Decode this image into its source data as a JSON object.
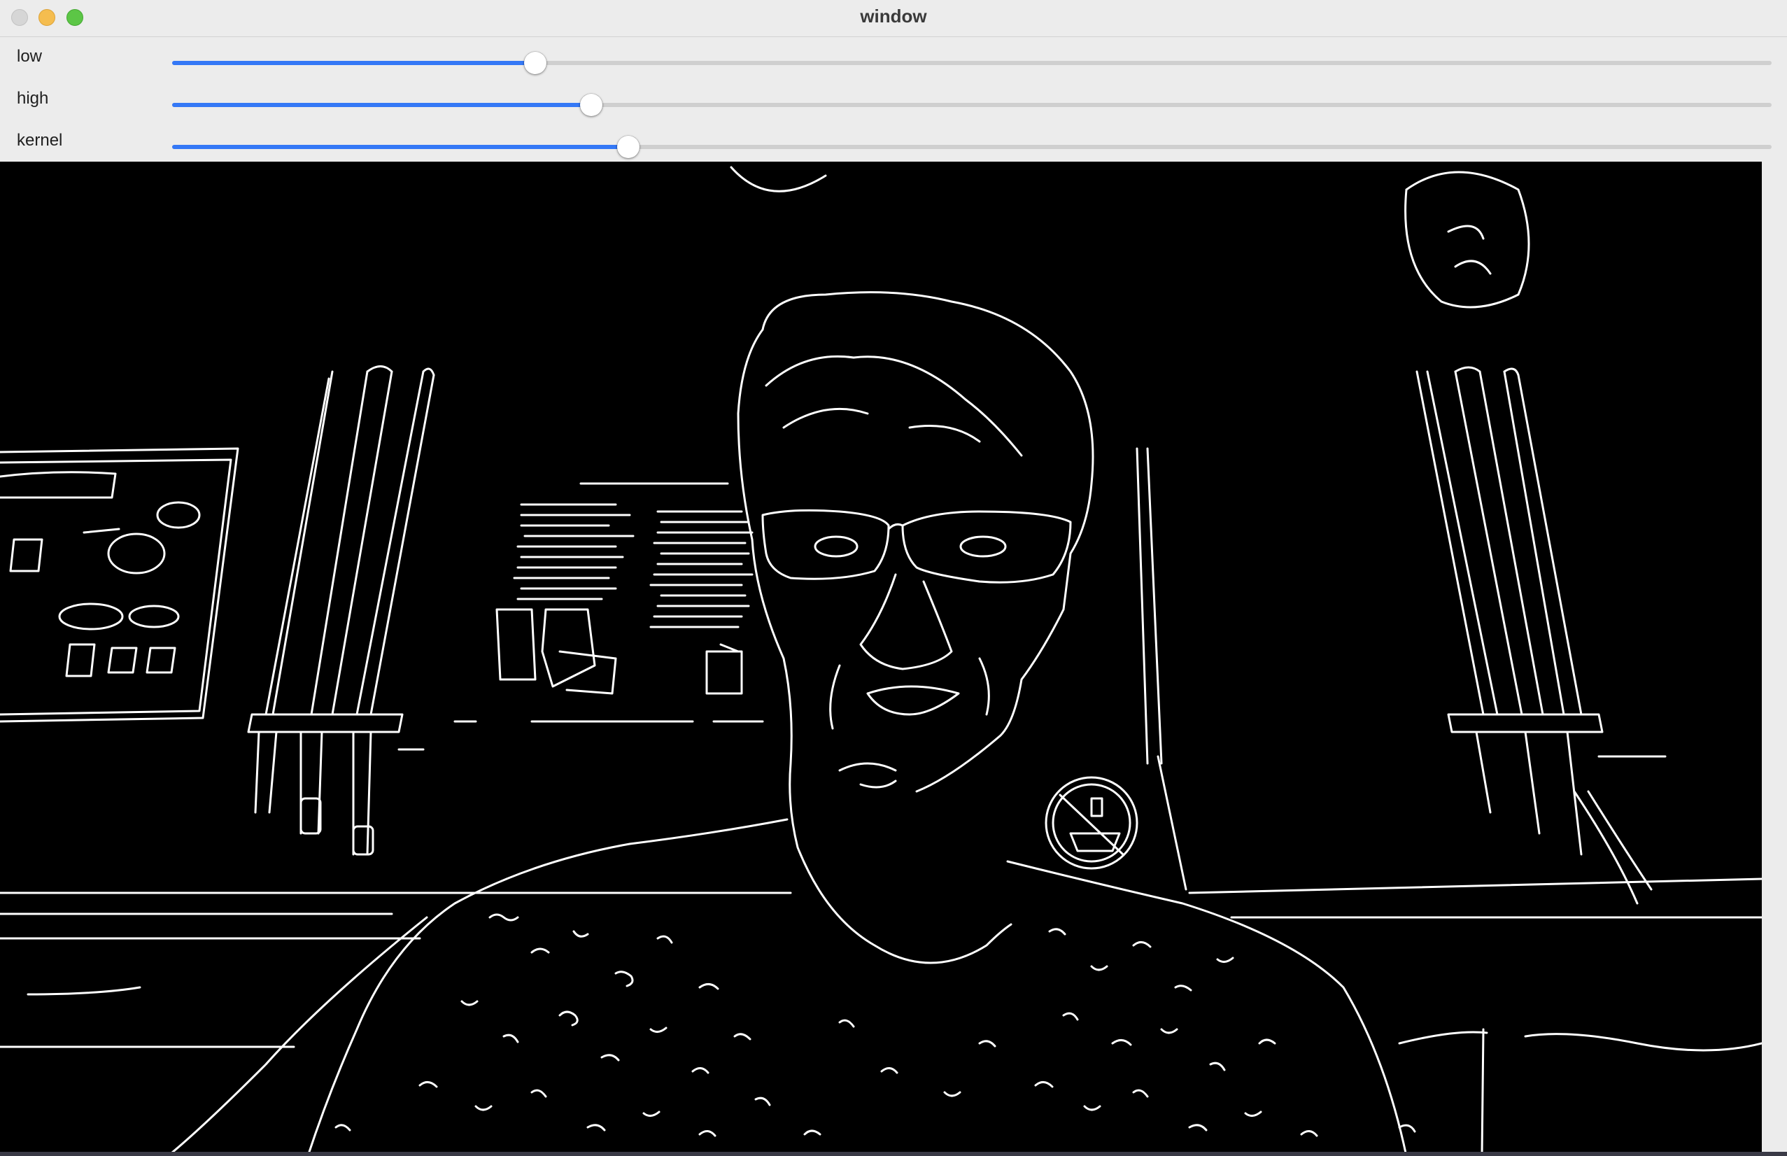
{
  "window": {
    "title": "window"
  },
  "controls": [
    {
      "label": "low",
      "value_fraction": 0.227
    },
    {
      "label": "high",
      "value_fraction": 0.262
    },
    {
      "label": "kernel",
      "value_fraction": 0.285
    }
  ],
  "colors": {
    "accent": "#3478f6",
    "titlebar": "#ececec",
    "image_background": "#000000",
    "edges": "#ffffff"
  }
}
